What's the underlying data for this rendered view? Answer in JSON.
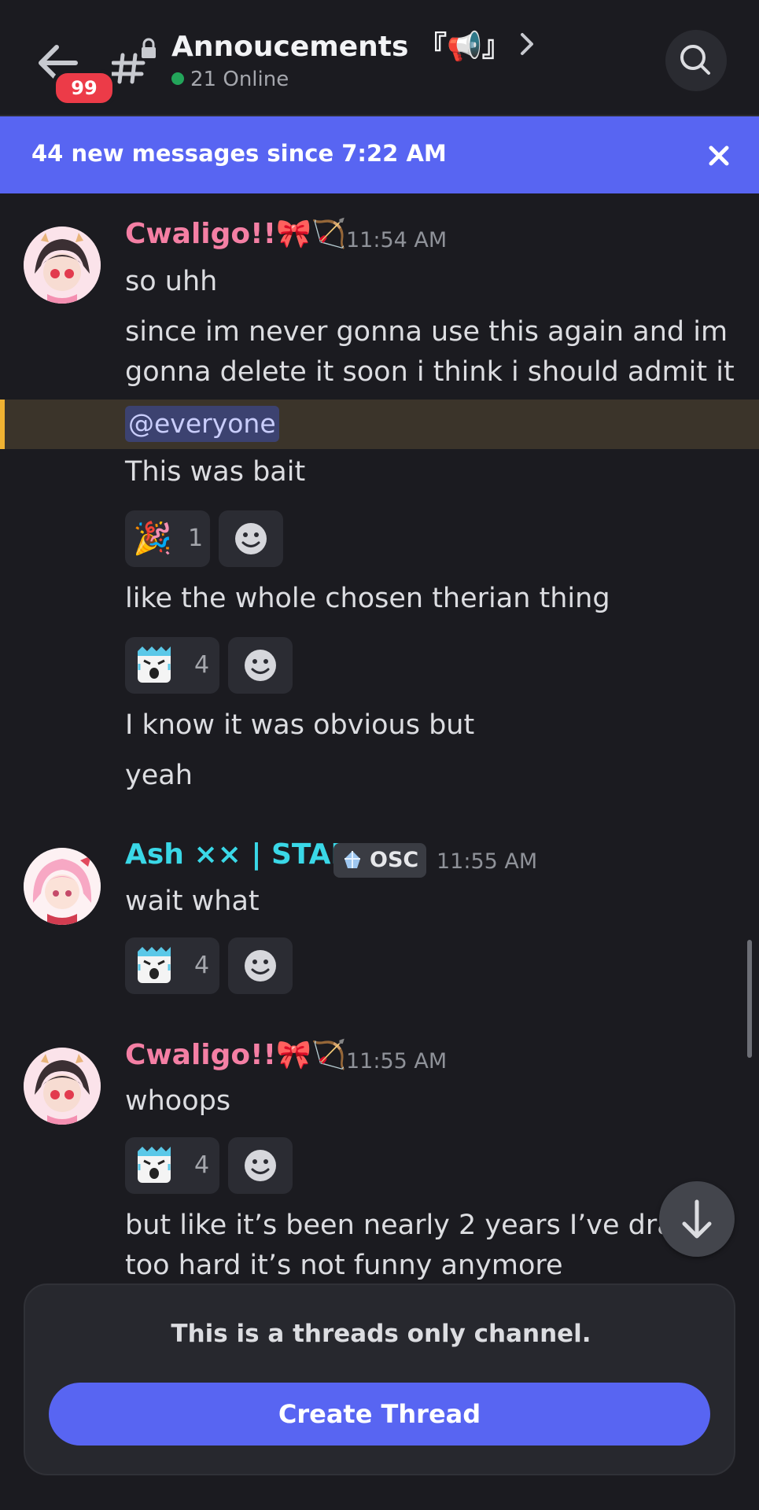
{
  "header": {
    "unread_count": "99",
    "channel_title": "Annoucements 『📢』",
    "online_text": "21 Online"
  },
  "banner": {
    "text": "44 new messages since 7:22 AM"
  },
  "messages": [
    {
      "author": "Cwaligo!!🎀🏹",
      "author_color": "#f47fa4",
      "time": "11:54 AM",
      "lines": [
        "so uhh",
        "since im never gonna use this again and im",
        "gonna delete it soon i think i should admit it",
        "@everyone",
        "This was bait",
        "like the whole chosen therian thing",
        "I know it was obvious but",
        "yeah"
      ],
      "reactions": [
        {
          "emoji": "🎉",
          "count": "1"
        },
        {
          "emoji": "panic-face",
          "count": "4"
        }
      ]
    },
    {
      "author": "Ash ×× | STAFF",
      "author_color": "#3ad8e7",
      "tag": "OSC",
      "time": "11:55 AM",
      "lines": [
        "wait what"
      ],
      "reactions": [
        {
          "emoji": "panic-face",
          "count": "4"
        }
      ]
    },
    {
      "author": "Cwaligo!!🎀🏹",
      "author_color": "#f47fa4",
      "time": "11:55 AM",
      "lines": [
        "whoops",
        "but like it’s been nearly 2 years I’ve dragg",
        "too hard it’s not funny anymore"
      ],
      "reactions": [
        {
          "emoji": "panic-face",
          "count": "4"
        }
      ]
    }
  ],
  "composer": {
    "notice": "This is a threads only channel.",
    "button_label": "Create Thread"
  },
  "colors": {
    "accent": "#5865f2",
    "mention_bar": "#f0b232",
    "badge": "#ec3b48"
  }
}
